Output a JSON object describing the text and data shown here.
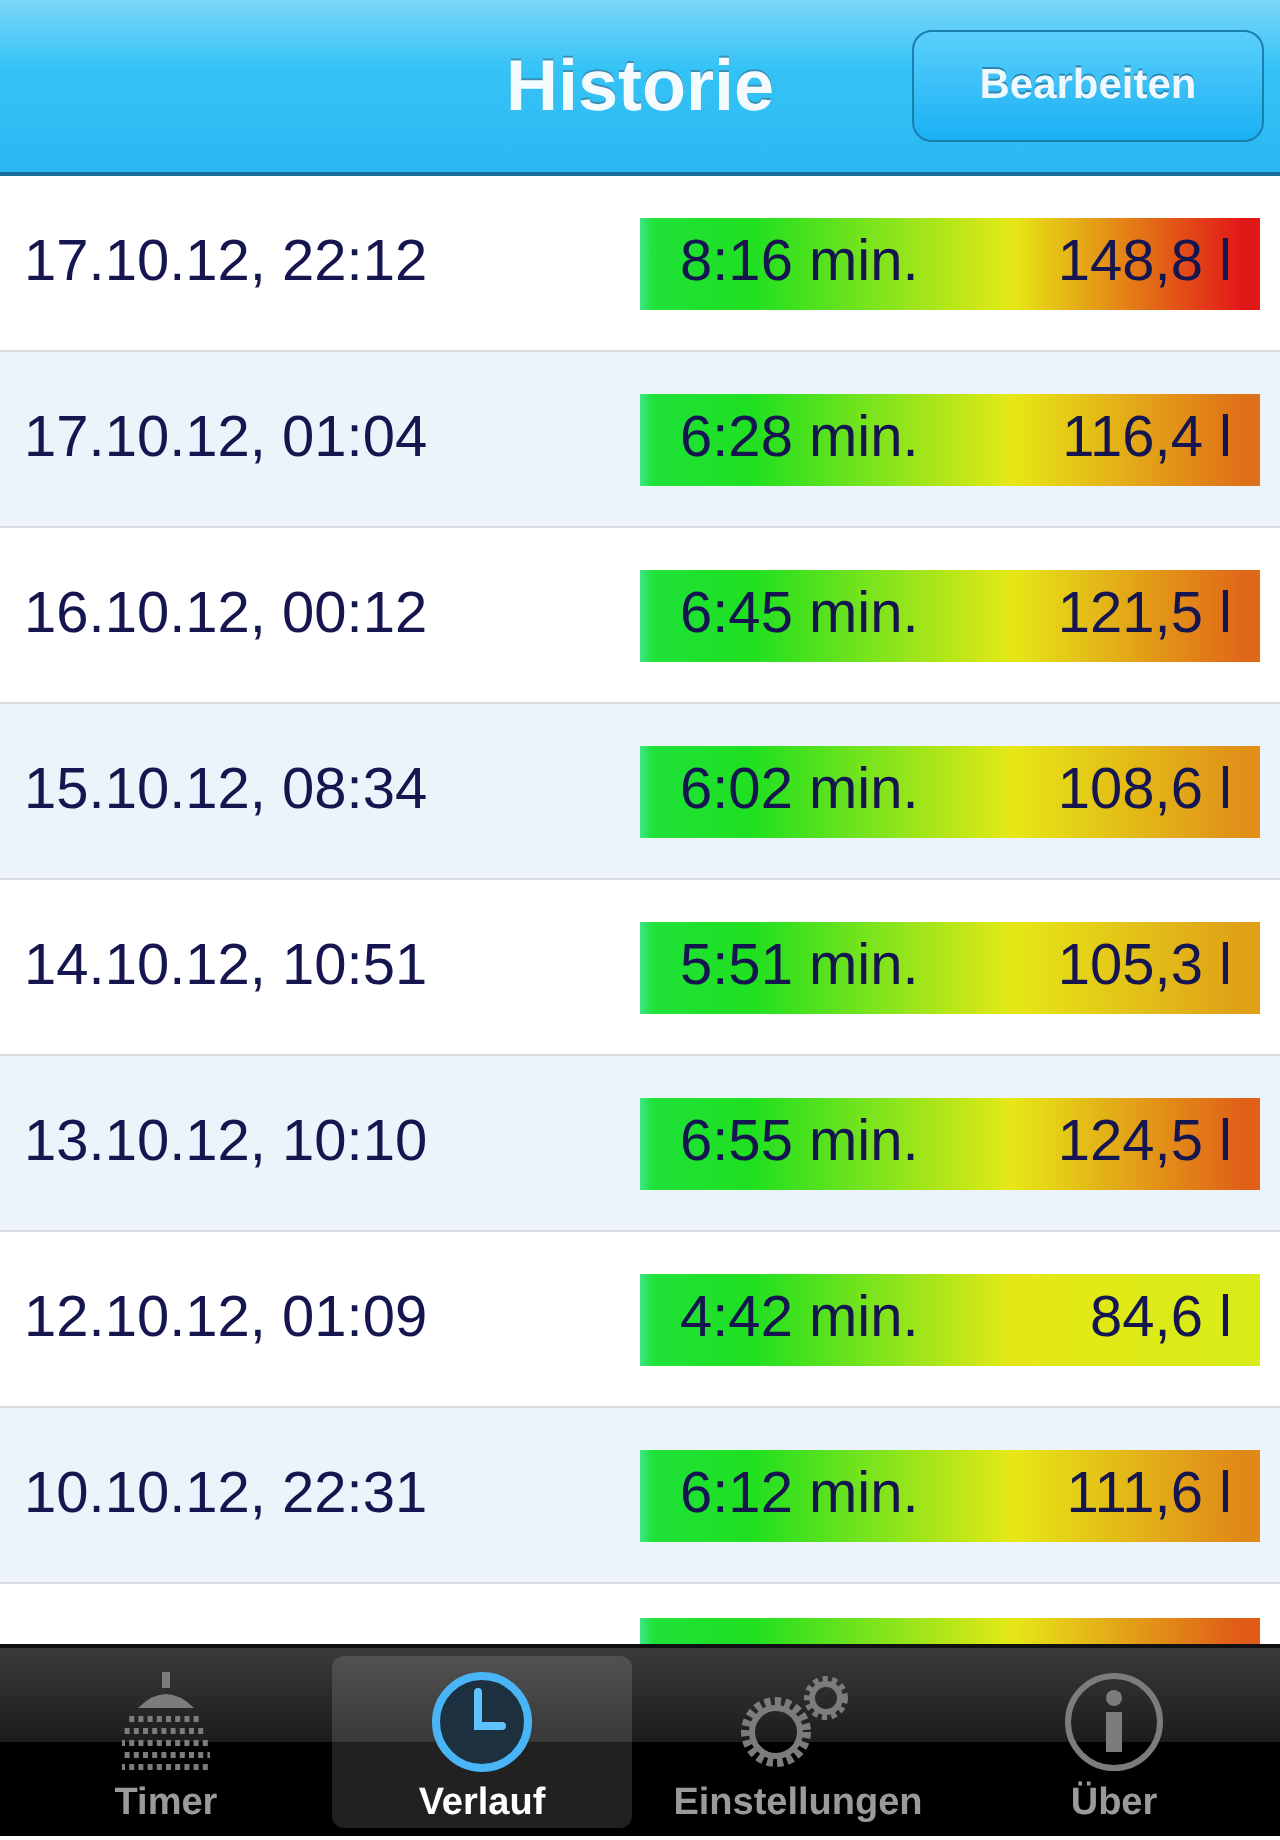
{
  "header": {
    "title": "Historie",
    "edit_button": "Bearbeiten"
  },
  "rows": [
    {
      "date": "17.10.12, 22:12",
      "duration": "8:16 min.",
      "volume": "148,8 l",
      "color": "#e21818"
    },
    {
      "date": "17.10.12, 01:04",
      "duration": "6:28 min.",
      "volume": "116,4 l",
      "color": "#e07018"
    },
    {
      "date": "16.10.12, 00:12",
      "duration": "6:45 min.",
      "volume": "121,5 l",
      "color": "#e06818"
    },
    {
      "date": "15.10.12, 08:34",
      "duration": "6:02 min.",
      "volume": "108,6 l",
      "color": "#e09018"
    },
    {
      "date": "14.10.12, 10:51",
      "duration": "5:51 min.",
      "volume": "105,3 l",
      "color": "#e0a018"
    },
    {
      "date": "13.10.12, 10:10",
      "duration": "6:55 min.",
      "volume": "124,5 l",
      "color": "#e06018"
    },
    {
      "date": "12.10.12, 01:09",
      "duration": "4:42 min.",
      "volume": "84,6 l",
      "color": "#d8ec18"
    },
    {
      "date": "10.10.12, 22:31",
      "duration": "6:12 min.",
      "volume": "111,6 l",
      "color": "#e08818"
    }
  ],
  "partial_row": {
    "color": "#e05a18"
  },
  "tabs": [
    {
      "label": "Timer",
      "selected": false
    },
    {
      "label": "Verlauf",
      "selected": true
    },
    {
      "label": "Einstellungen",
      "selected": false
    },
    {
      "label": "Über",
      "selected": false
    }
  ]
}
